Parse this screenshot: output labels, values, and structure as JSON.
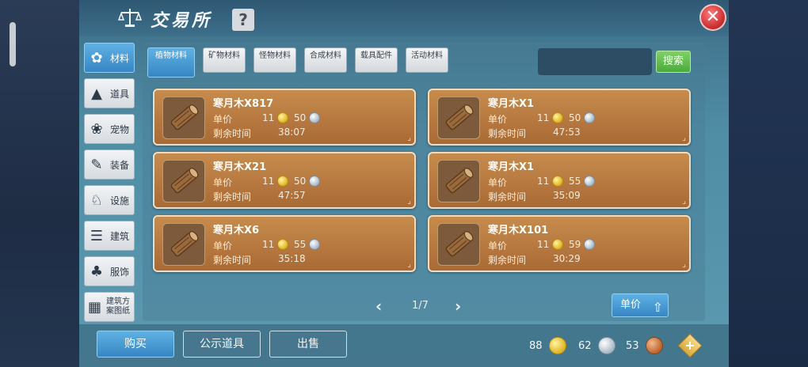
{
  "window": {
    "title": "交易所",
    "help_label": "?",
    "close_label": "✕"
  },
  "sidebar": {
    "items": [
      {
        "label": "材料",
        "icon": "ore-icon",
        "glyph": "✿"
      },
      {
        "label": "道具",
        "icon": "potion-icon",
        "glyph": "▲"
      },
      {
        "label": "宠物",
        "icon": "paw-icon",
        "glyph": "❀"
      },
      {
        "label": "装备",
        "icon": "armor-icon",
        "glyph": "✎"
      },
      {
        "label": "设施",
        "icon": "facility-icon",
        "glyph": "♘"
      },
      {
        "label": "建筑",
        "icon": "building-icon",
        "glyph": "☰"
      },
      {
        "label": "服饰",
        "icon": "clothes-icon",
        "glyph": "♣"
      },
      {
        "label": "建筑方案图纸",
        "icon": "blueprint-icon",
        "glyph": "▦"
      }
    ],
    "active_index": 0
  },
  "tabs": {
    "items": [
      "植物材料",
      "矿物材料",
      "怪物材料",
      "合成材料",
      "载具配件",
      "活动材料"
    ],
    "active_index": 0
  },
  "search": {
    "placeholder": "",
    "button_label": "搜索"
  },
  "listings": [
    {
      "name": "寒月木X817",
      "price_label": "单价",
      "gold": "11",
      "silver": "50",
      "time_label": "剩余时间",
      "time": "38:07"
    },
    {
      "name": "寒月木X1",
      "price_label": "单价",
      "gold": "11",
      "silver": "50",
      "time_label": "剩余时间",
      "time": "47:53"
    },
    {
      "name": "寒月木X21",
      "price_label": "单价",
      "gold": "11",
      "silver": "50",
      "time_label": "剩余时间",
      "time": "47:57"
    },
    {
      "name": "寒月木X1",
      "price_label": "单价",
      "gold": "11",
      "silver": "55",
      "time_label": "剩余时间",
      "time": "35:09"
    },
    {
      "name": "寒月木X6",
      "price_label": "单价",
      "gold": "11",
      "silver": "55",
      "time_label": "剩余时间",
      "time": "35:18"
    },
    {
      "name": "寒月木X101",
      "price_label": "单价",
      "gold": "11",
      "silver": "59",
      "time_label": "剩余时间",
      "time": "30:29"
    }
  ],
  "pager": {
    "prev": "‹",
    "text": "1/7",
    "next": "›"
  },
  "sort_button": {
    "label": "单价",
    "arrow": "⇧"
  },
  "bottom": {
    "buy_label": "购买",
    "public_label": "公示道具",
    "sell_label": "出售",
    "gold": "88",
    "silver": "62",
    "copper": "53",
    "plus_label": "+"
  },
  "colors": {
    "accent_blue": "#3786c4",
    "card_brown": "#a96a35",
    "search_green": "#4caa3c",
    "close_red": "#c62b2b"
  }
}
